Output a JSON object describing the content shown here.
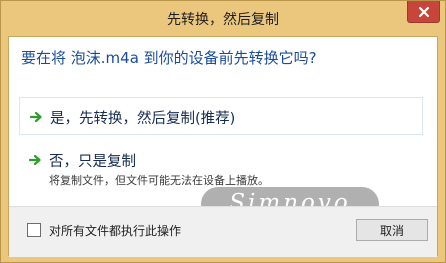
{
  "window": {
    "title": "先转换，然后复制",
    "close_icon": "close-x-icon"
  },
  "question": "要在将 泡沫.m4a 到你的设备前先转换它吗?",
  "options": [
    {
      "icon": "green-arrow-icon",
      "label": "是，先转换，然后复制(推荐)"
    },
    {
      "icon": "green-arrow-icon",
      "label": "否，只是复制",
      "sub": "将复制文件，但文件可能无法在设备上播放。"
    }
  ],
  "footer": {
    "checkbox_label": "对所有文件都执行此操作",
    "checkbox_checked": false,
    "cancel_label": "取消"
  },
  "watermark": "Simnovo",
  "colors": {
    "frame": "#ebc77e",
    "close": "#c7453a",
    "accent_text": "#1a4c9c",
    "arrow": "#2f9e28"
  }
}
